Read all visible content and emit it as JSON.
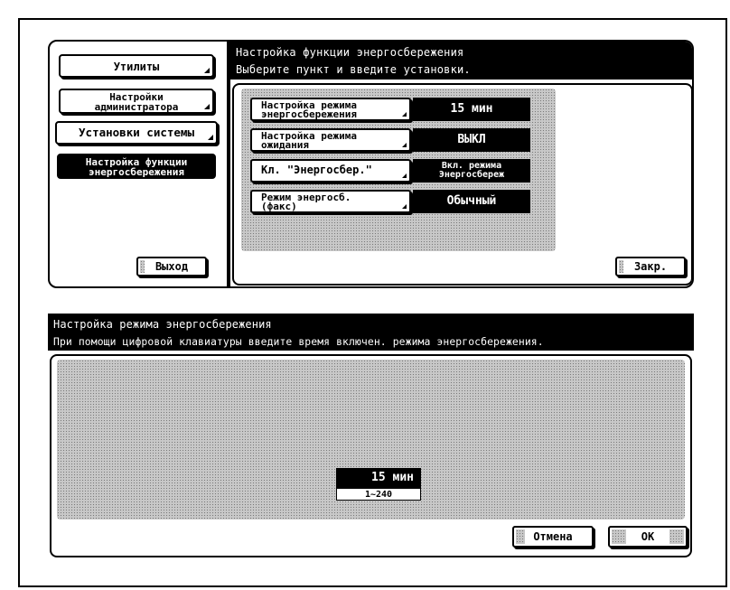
{
  "top_panel": {
    "header": {
      "title": "Настройка функции энергосбережения",
      "subtitle": "Выберите пункт и введите установки."
    },
    "nav": {
      "utilities": "Утилиты",
      "admin_line1": "Настройки",
      "admin_line2": "администратора",
      "system": "Установки системы",
      "energy_line1": "Настройка функции",
      "energy_line2": "энергосбережения",
      "exit": "Выход"
    },
    "settings": [
      {
        "label_line1": "Настройка режима",
        "label_line2": "энергосбережения",
        "value_line1": "15 мин",
        "value_line2": ""
      },
      {
        "label_line1": "Настройка режима",
        "label_line2": "ожидания",
        "value_line1": "ВЫКЛ",
        "value_line2": ""
      },
      {
        "label_line1": "Кл. \"Энергосбер.\"",
        "label_line2": "",
        "value_line1": "Вкл. режима",
        "value_line2": "Энергосбереж"
      },
      {
        "label_line1": "Режим энергосб.",
        "label_line2": "(факс)",
        "value_line1": "Обычный",
        "value_line2": ""
      }
    ],
    "close": "Закр."
  },
  "bottom_panel": {
    "header": {
      "title": "Настройка режима энергосбережения",
      "subtitle": "При помощи цифровой клавиатуры введите время включен. режима энергосбережения."
    },
    "value": "15 мин",
    "range": "1~240",
    "cancel": "Отмена",
    "ok": "OK"
  },
  "colors": {
    "foreground": "#000000",
    "background": "#ffffff",
    "dither": "#c8c8c8"
  }
}
